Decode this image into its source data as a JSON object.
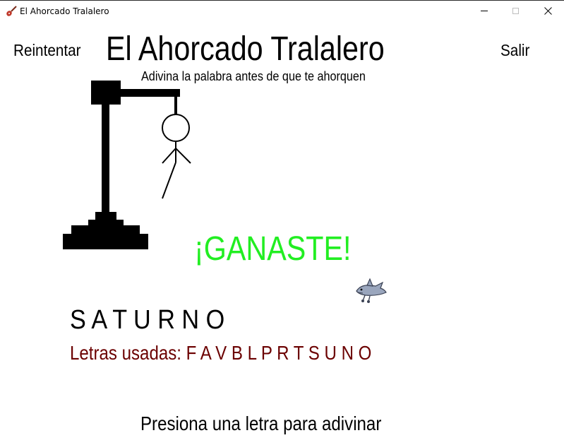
{
  "window": {
    "title": "El Ahorcado Tralalero"
  },
  "menu": {
    "retry_label": "Reintentar",
    "exit_label": "Salir"
  },
  "header": {
    "title": "El Ahorcado Tralalero",
    "subtitle": "Adivina la palabra antes de que te ahorquen"
  },
  "game": {
    "result": "¡GANASTE!",
    "word_display": "S A T U R N O",
    "used_letters_label": "Letras usadas: F A V B L P R T S U N O",
    "prompt": "Presiona una letra para adivinar"
  },
  "colors": {
    "win": "#22ee22",
    "used_letters": "#6b0000",
    "text": "#000000"
  },
  "icons": {
    "app": "guitar-icon",
    "mascot": "shark-icon"
  }
}
